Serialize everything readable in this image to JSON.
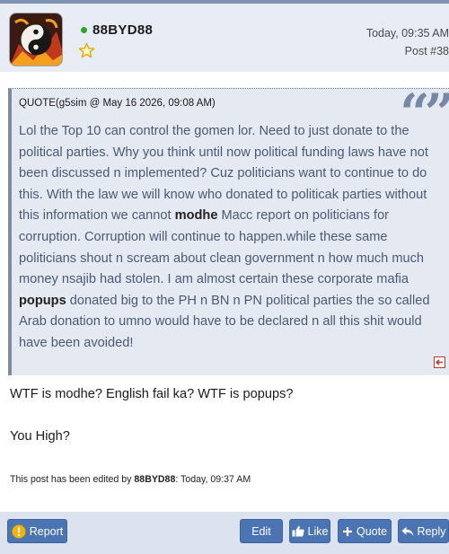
{
  "post": {
    "username": "88BYD88",
    "timestamp": "Today, 09:35 AM",
    "post_number": "Post #38",
    "online_color": "#2aa52a"
  },
  "quote": {
    "header": "QUOTE(g5sim @ May 16 2026, 09:08 AM)",
    "text_1": "Lol the Top 10 can control the gomen lor. Need to just donate to the political parties. Why you think until now political funding laws have not been discussed n implemented? Cuz politicians want to continue to do this. With the law we will know who donated to politicak parties without this information we cannot ",
    "bold_1": "modhe",
    "text_2": " Macc report on politicians for corruption. Corruption will continue to happen.while these same politicians shout n scream about clean government n how much much money nsajib had stolen. I am almost certain these corporate mafia ",
    "bold_2": "popups",
    "text_3": " donated big to the PH n BN n PN political parties the so called Arab donation to umno would have to be declared n all this shit would have been avoided!"
  },
  "reply": {
    "line_1": "WTF is modhe? English fail ka? WTF is popups?",
    "line_2": "You High?"
  },
  "edit_note": {
    "prefix": "This post has been edited by ",
    "editor": "88BYD88",
    "suffix": ": Today, 09:37 AM"
  },
  "footer": {
    "report_label": "Report",
    "edit_label": "Edit",
    "like_label": "Like",
    "quote_label": "Quote",
    "reply_label": "Reply"
  },
  "icons": {
    "avatar": "yin-yang-dragon-avatar",
    "rank": "star-icon",
    "jump": "jump-to-post-icon",
    "report": "exclamation-icon",
    "like": "thumbs-up-icon",
    "quote": "plus-icon",
    "reply": "reply-arrow-icon"
  },
  "colors": {
    "accent": "#4b74b3",
    "header_bg": "#e8edf5",
    "quote_bg": "#e4e9f2",
    "report_icon": "#f0b400"
  }
}
